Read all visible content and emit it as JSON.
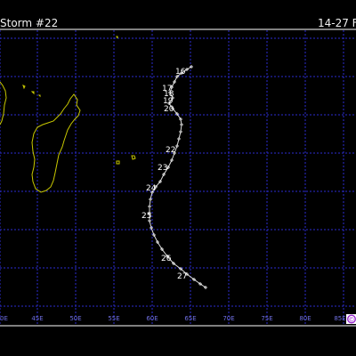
{
  "header": {
    "title": "Storm #22",
    "date_range": "14-27 F"
  },
  "colors": {
    "background": "#000000",
    "grid": "#2b2bd0",
    "coast": "#c8c800",
    "track": "#dddddd",
    "lon_label": "#6f6fe0",
    "frame": "#ffffff"
  },
  "longitudes": [
    "0E",
    "45E",
    "50E",
    "55E",
    "60E",
    "65E",
    "70E",
    "75E",
    "80E",
    "85E"
  ],
  "logo": {
    "icon": "copyright-logo-icon",
    "text": "©"
  },
  "track": {
    "days": [
      {
        "label": "16"
      },
      {
        "label": "17"
      },
      {
        "label": "18"
      },
      {
        "label": "19"
      },
      {
        "label": "20"
      },
      {
        "label": "22"
      },
      {
        "label": "23"
      },
      {
        "label": "24"
      },
      {
        "label": "25"
      },
      {
        "label": "26"
      },
      {
        "label": "27"
      }
    ]
  }
}
